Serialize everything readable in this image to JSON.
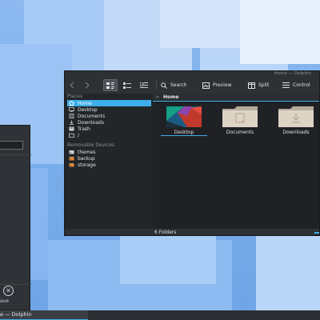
{
  "dolphin": {
    "window_title": "Home — Dolphin",
    "toolbar": {
      "search_label": "Search",
      "preview_label": "Preview",
      "split_label": "Split",
      "control_label": "Control"
    },
    "places": {
      "header": "Places",
      "items": [
        {
          "label": "Home",
          "icon": "home-icon",
          "active": true
        },
        {
          "label": "Desktop",
          "icon": "desktop-icon"
        },
        {
          "label": "Documents",
          "icon": "documents-icon"
        },
        {
          "label": "Downloads",
          "icon": "downloads-icon"
        },
        {
          "label": "Trash",
          "icon": "trash-icon"
        },
        {
          "label": "/",
          "icon": "root-folder-icon"
        }
      ],
      "devices_header": "Removable Devices",
      "devices": [
        {
          "label": "themes",
          "icon": "drive-icon"
        },
        {
          "label": "backup",
          "icon": "drive-icon"
        },
        {
          "label": "storage",
          "icon": "drive-icon"
        }
      ]
    },
    "breadcrumb": {
      "separator": ">",
      "current": "Home"
    },
    "files": [
      {
        "name": "Desktop",
        "icon": "desktop-folder-icon"
      },
      {
        "name": "Documents",
        "icon": "folder-icon"
      },
      {
        "name": "Downloads",
        "icon": "download-folder-icon"
      }
    ],
    "status": "6 Folders"
  },
  "background_window": {
    "button_label": "ave"
  },
  "taskbar": {
    "task_label": "e — Dolphin"
  },
  "colors": {
    "accent": "#3daee9",
    "window_bg": "#232629",
    "wallpaper": "#7fb2ee"
  }
}
